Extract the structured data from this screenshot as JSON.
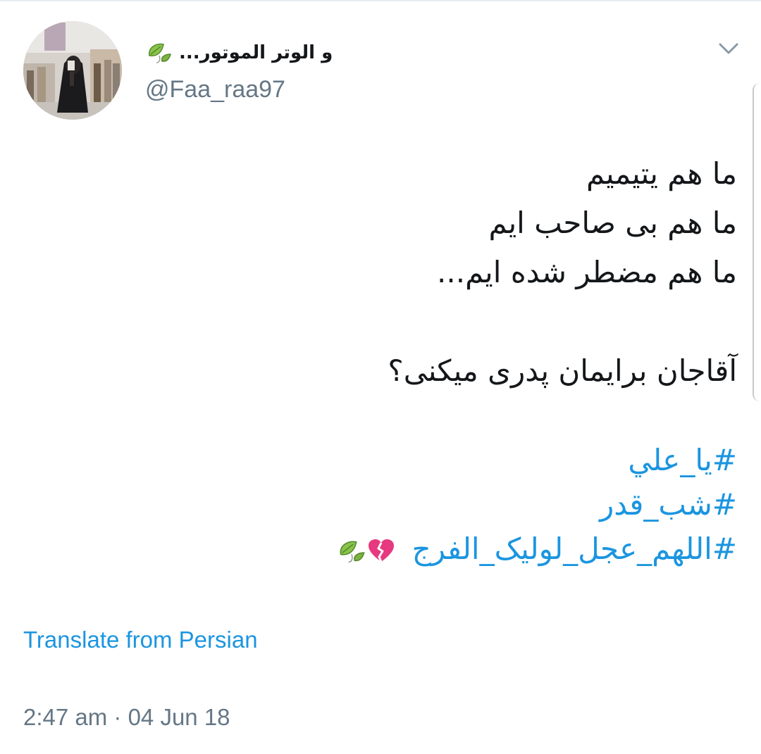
{
  "tweet": {
    "author": {
      "display_name": "و الوتر الموتور...",
      "handle": "@Faa_raa97",
      "name_emoji": "leaf-icon",
      "avatar": "profile-photo"
    },
    "menu_icon": "chevron-down-icon",
    "body_lines": [
      "ما هم یتیمیم",
      "ما هم بی صاحب ایم",
      "ما هم مضطر شده ایم..."
    ],
    "question": "آقاجان برایمان پدری میکنی؟",
    "hashtags": [
      "#یا_علي",
      "#شب_قدر",
      "#اللهم_عجل_لولیک_الفرج"
    ],
    "trailing_emojis": [
      "broken-heart-icon",
      "leaf-icon"
    ],
    "translate_label": "Translate from Persian",
    "timestamp": "2:47 am · 04 Jun 18"
  },
  "colors": {
    "text": "#14171a",
    "secondary": "#657786",
    "link": "#1b95e0",
    "divider": "#e6ecf0"
  }
}
